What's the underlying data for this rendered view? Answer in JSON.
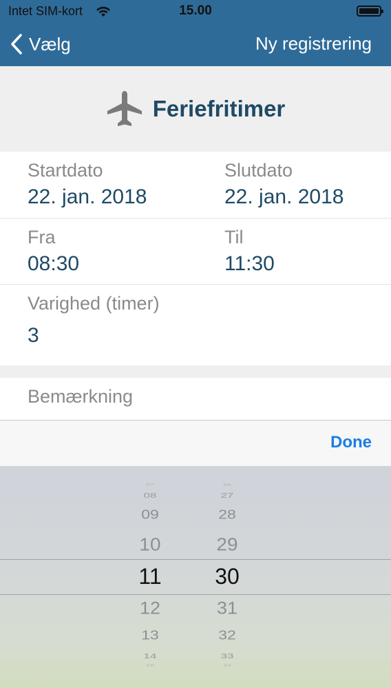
{
  "status": {
    "carrier": "Intet SIM-kort",
    "time": "15.00"
  },
  "nav": {
    "back_label": "Vælg",
    "action_label": "Ny registrering"
  },
  "header": {
    "title": "Feriefritimer",
    "icon": "airplane-icon"
  },
  "fields": {
    "start_date": {
      "label": "Startdato",
      "value": "22. jan. 2018"
    },
    "end_date": {
      "label": "Slutdato",
      "value": "22. jan. 2018"
    },
    "from": {
      "label": "Fra",
      "value": "08:30"
    },
    "to": {
      "label": "Til",
      "value": "11:30"
    },
    "duration": {
      "label": "Varighed (timer)",
      "value": "3"
    }
  },
  "remark": {
    "placeholder": "Bemærkning"
  },
  "toolbar": {
    "done_label": "Done"
  },
  "picker": {
    "hours": [
      "07",
      "08",
      "09",
      "10",
      "11",
      "12",
      "13",
      "14",
      "15"
    ],
    "minutes": [
      "26",
      "27",
      "28",
      "29",
      "30",
      "31",
      "32",
      "33",
      "34"
    ],
    "selected_hour": "11",
    "selected_minute": "30"
  },
  "colors": {
    "nav": "#2f6b98",
    "accent": "#1a7ee6",
    "value_text": "#1e4a66"
  }
}
